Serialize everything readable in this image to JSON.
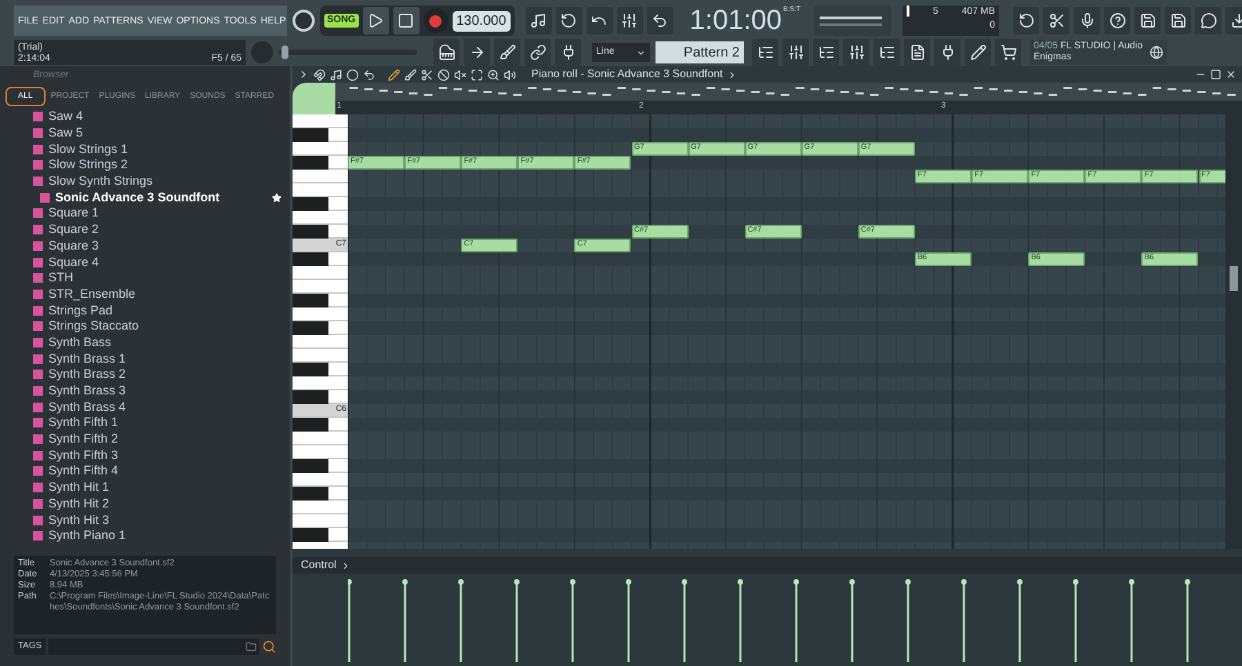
{
  "menu": [
    "FILE",
    "EDIT",
    "ADD",
    "PATTERNS",
    "VIEW",
    "OPTIONS",
    "TOOLS",
    "HELP"
  ],
  "transport": {
    "song_label": "SONG",
    "song_mode": true,
    "tempo": "130.000"
  },
  "time": {
    "value": "1:01:00",
    "unit": "B:S:T"
  },
  "hint": {
    "title": "(Trial)",
    "time": "2:14:04",
    "count": "F5 / 65"
  },
  "master_pitch": {
    "level": 0.02
  },
  "cpu": {
    "polyphony": "5",
    "memory": "407 MB",
    "value": "0"
  },
  "snap": {
    "value": "Line"
  },
  "pattern": {
    "value": "Pattern 2"
  },
  "news": {
    "count": "04/05",
    "text": "FL STUDIO | Audio Enigmas"
  },
  "browser": {
    "title": "Browser",
    "tabs": [
      {
        "label": "ALL",
        "selected": true
      },
      {
        "label": "PROJECT",
        "selected": false
      },
      {
        "label": "PLUGINS",
        "selected": false
      },
      {
        "label": "LIBRARY",
        "selected": false
      },
      {
        "label": "SOUNDS",
        "selected": false
      },
      {
        "label": "STARRED",
        "selected": false
      }
    ],
    "items": [
      {
        "label": "Saw 4",
        "selected": false
      },
      {
        "label": "Saw 5",
        "selected": false
      },
      {
        "label": "Slow Strings 1",
        "selected": false
      },
      {
        "label": "Slow Strings 2",
        "selected": false
      },
      {
        "label": "Slow Synth Strings",
        "selected": false
      },
      {
        "label": "Sonic Advance 3 Soundfont",
        "selected": true
      },
      {
        "label": "Square 1",
        "selected": false
      },
      {
        "label": "Square 2",
        "selected": false
      },
      {
        "label": "Square 3",
        "selected": false
      },
      {
        "label": "Square 4",
        "selected": false
      },
      {
        "label": "STH",
        "selected": false
      },
      {
        "label": "STR_Ensemble",
        "selected": false
      },
      {
        "label": "Strings Pad",
        "selected": false
      },
      {
        "label": "Strings Staccato",
        "selected": false
      },
      {
        "label": "Synth Bass",
        "selected": false
      },
      {
        "label": "Synth Brass 1",
        "selected": false
      },
      {
        "label": "Synth Brass 2",
        "selected": false
      },
      {
        "label": "Synth Brass 3",
        "selected": false
      },
      {
        "label": "Synth Brass 4",
        "selected": false
      },
      {
        "label": "Synth Fifth 1",
        "selected": false
      },
      {
        "label": "Synth Fifth 2",
        "selected": false
      },
      {
        "label": "Synth Fifth 3",
        "selected": false
      },
      {
        "label": "Synth Fifth 4",
        "selected": false
      },
      {
        "label": "Synth Hit 1",
        "selected": false
      },
      {
        "label": "Synth Hit 2",
        "selected": false
      },
      {
        "label": "Synth Hit 3",
        "selected": false
      },
      {
        "label": "Synth Piano 1",
        "selected": false
      }
    ],
    "info": [
      {
        "label": "Title",
        "value": "Sonic Advance 3 Soundfont.sf2"
      },
      {
        "label": "Date",
        "value": "4/13/2025 3:45:56 PM"
      },
      {
        "label": "Size",
        "value": "8.94 MB"
      },
      {
        "label": "Path",
        "value": "C:\\Program Files\\Image-Line\\FL Studio 2024\\Data\\Patches\\Soundfonts\\Sonic Advance 3 Soundfont.sf2"
      }
    ],
    "tags_label": "TAGS"
  },
  "piano_roll": {
    "title": "Piano roll - Sonic Advance 3 Soundfont",
    "ruler": [
      "1",
      "2",
      "3"
    ],
    "keys": [
      "C7",
      "C6"
    ],
    "notes": [
      {
        "label": "G7"
      },
      {
        "label": "G7"
      },
      {
        "label": "G7"
      },
      {
        "label": "G7"
      },
      {
        "label": "G7"
      },
      {
        "label": "F#7"
      },
      {
        "label": "F#7"
      },
      {
        "label": "F#7"
      },
      {
        "label": "F#7"
      },
      {
        "label": "F#7"
      },
      {
        "label": "F7"
      },
      {
        "label": "F7"
      },
      {
        "label": "F7"
      },
      {
        "label": "F7"
      },
      {
        "label": "F7"
      },
      {
        "label": "F7"
      },
      {
        "label": "C#7"
      },
      {
        "label": "C#7"
      },
      {
        "label": "C#7"
      },
      {
        "label": "C7"
      },
      {
        "label": "C7"
      },
      {
        "label": "B6"
      },
      {
        "label": "B6"
      },
      {
        "label": "B6"
      }
    ],
    "lane": "Control"
  }
}
